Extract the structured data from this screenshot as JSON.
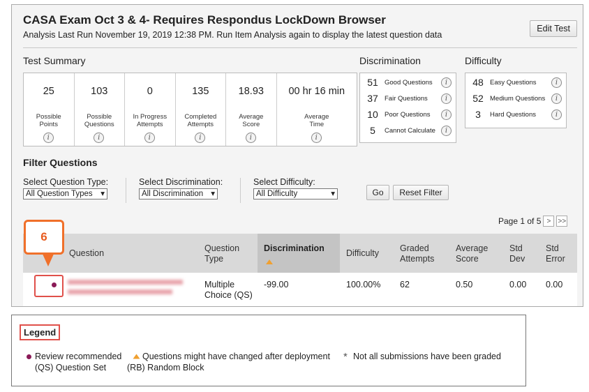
{
  "header": {
    "title": "CASA Exam Oct 3 & 4- Requires Respondus LockDown Browser",
    "subtitle": "Analysis Last Run  November 19, 2019 12:38 PM.  Run Item Analysis again to display the latest question data",
    "edit_button": "Edit Test"
  },
  "test_summary": {
    "heading": "Test Summary",
    "cells": [
      {
        "value": "25",
        "label_line1": "Possible",
        "label_line2": "Points"
      },
      {
        "value": "103",
        "label_line1": "Possible",
        "label_line2": "Questions"
      },
      {
        "value": "0",
        "label_line1": "In Progress",
        "label_line2": "Attempts"
      },
      {
        "value": "135",
        "label_line1": "Completed",
        "label_line2": "Attempts"
      },
      {
        "value": "18.93",
        "label_line1": "Average",
        "label_line2": "Score"
      },
      {
        "value": "00 hr 16 min",
        "label_line1": "Average",
        "label_line2": "Time"
      }
    ]
  },
  "discrimination": {
    "heading": "Discrimination",
    "rows": [
      {
        "count": "51",
        "label": "Good Questions"
      },
      {
        "count": "37",
        "label": "Fair Questions"
      },
      {
        "count": "10",
        "label": "Poor Questions"
      },
      {
        "count": "5",
        "label": "Cannot Calculate"
      }
    ]
  },
  "difficulty": {
    "heading": "Difficulty",
    "rows": [
      {
        "count": "48",
        "label": "Easy Questions"
      },
      {
        "count": "52",
        "label": "Medium Questions"
      },
      {
        "count": "3",
        "label": "Hard Questions"
      }
    ]
  },
  "filter": {
    "heading": "Filter Questions",
    "type_label": "Select Question Type:",
    "type_value": "All Question Types",
    "disc_label": "Select Discrimination:",
    "disc_value": "All Discrimination",
    "diff_label": "Select Difficulty:",
    "diff_value": "All Difficulty",
    "go_button": "Go",
    "reset_button": "Reset Filter"
  },
  "pager": {
    "text": "Page 1 of 5",
    "next": ">",
    "last": ">>"
  },
  "table": {
    "headers": {
      "question": "Question",
      "type_l1": "Question",
      "type_l2": "Type",
      "discrimination": "Discrimination",
      "difficulty": "Difficulty",
      "graded_l1": "Graded",
      "graded_l2": "Attempts",
      "avg_l1": "Average",
      "avg_l2": "Score",
      "std_dev_l1": "Std",
      "std_dev_l2": "Dev",
      "std_err_l1": "Std",
      "std_err_l2": "Error"
    },
    "rows": [
      {
        "type_l1": "Multiple",
        "type_l2": "Choice (QS)",
        "discrimination": "-99.00",
        "difficulty": "100.00%",
        "graded_attempts": "62",
        "average_score": "0.50",
        "std_dev": "0.00",
        "std_error": "0.00"
      }
    ]
  },
  "callout": {
    "number": "6"
  },
  "legend": {
    "title": "Legend",
    "review": "Review recommended",
    "changed": "Questions might have changed after deployment",
    "not_graded": "Not all submissions have been graded",
    "qs": "(QS) Question Set",
    "rb": "(RB) Random Block"
  },
  "colors": {
    "review_dot": "#8a1a57",
    "changed_triangle": "#f0a030",
    "callout": "#f0702a",
    "highlight_frame": "#e0504a"
  }
}
